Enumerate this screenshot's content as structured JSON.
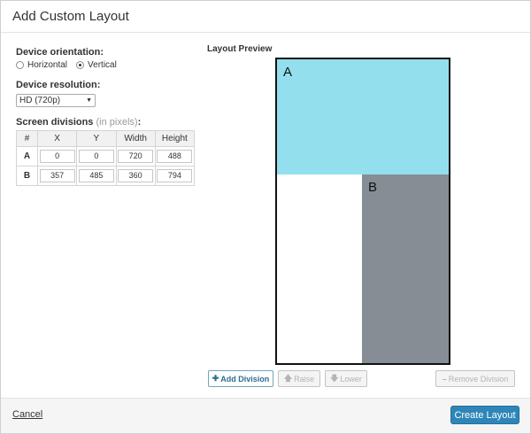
{
  "dialog": {
    "title": "Add Custom Layout"
  },
  "orientation": {
    "label": "Device orientation:",
    "options": [
      {
        "label": "Horizontal",
        "checked": false
      },
      {
        "label": "Vertical",
        "checked": true
      }
    ]
  },
  "resolution": {
    "label": "Device resolution:",
    "selected": "HD (720p)"
  },
  "divisions": {
    "label": "Screen divisions",
    "note": "(in pixels)",
    "colon": ":",
    "headers": [
      "#",
      "X",
      "Y",
      "Width",
      "Height"
    ],
    "rows": [
      {
        "id": "A",
        "x": "0",
        "y": "0",
        "width": "720",
        "height": "488"
      },
      {
        "id": "B",
        "x": "357",
        "y": "485",
        "width": "360",
        "height": "794"
      }
    ]
  },
  "preview": {
    "label": "Layout Preview",
    "colors": {
      "A": "#93dfee",
      "B": "#868d95"
    }
  },
  "toolbar": {
    "add": "Add Division",
    "raise": "Raise",
    "lower": "Lower",
    "remove": "Remove Division"
  },
  "footer": {
    "cancel": "Cancel",
    "create": "Create Layout"
  }
}
